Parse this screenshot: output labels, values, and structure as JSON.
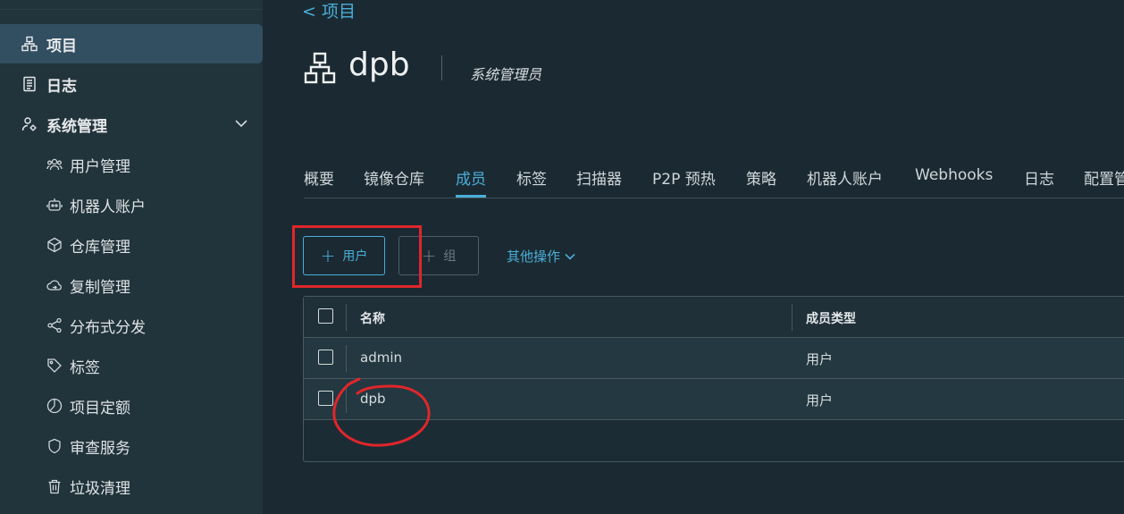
{
  "sidebar": {
    "items": [
      {
        "label": "项目",
        "icon": "project-icon",
        "active": true
      },
      {
        "label": "日志",
        "icon": "log-icon"
      },
      {
        "label": "系统管理",
        "icon": "admin-icon"
      }
    ],
    "subitems": [
      {
        "label": "用户管理",
        "icon": "users-icon"
      },
      {
        "label": "机器人账户",
        "icon": "robot-icon"
      },
      {
        "label": "仓库管理",
        "icon": "registry-icon"
      },
      {
        "label": "复制管理",
        "icon": "cloud-sync-icon"
      },
      {
        "label": "分布式分发",
        "icon": "share-icon"
      },
      {
        "label": "标签",
        "icon": "tag-icon"
      },
      {
        "label": "项目定额",
        "icon": "quota-icon"
      },
      {
        "label": "审查服务",
        "icon": "shield-icon"
      },
      {
        "label": "垃圾清理",
        "icon": "trash-icon"
      }
    ]
  },
  "breadcrumb": {
    "label": "<  项目"
  },
  "project": {
    "name": "dpb",
    "role": "系统管理员"
  },
  "tabs": [
    "概要",
    "镜像仓库",
    "成员",
    "标签",
    "扫描器",
    "P2P 预热",
    "策略",
    "机器人账户",
    "Webhooks",
    "日志",
    "配置管"
  ],
  "active_tab": "成员",
  "actions": {
    "add_user": "用户",
    "add_group": "组",
    "more": "其他操作"
  },
  "table": {
    "headers": [
      "名称",
      "成员类型"
    ],
    "rows": [
      {
        "name": "admin",
        "type": "用户"
      },
      {
        "name": "dpb",
        "type": "用户"
      }
    ]
  },
  "colors": {
    "accent": "#4aaed9",
    "annotation": "#e0262b",
    "background": "#1b2a32",
    "sidebar": "#21333b"
  }
}
